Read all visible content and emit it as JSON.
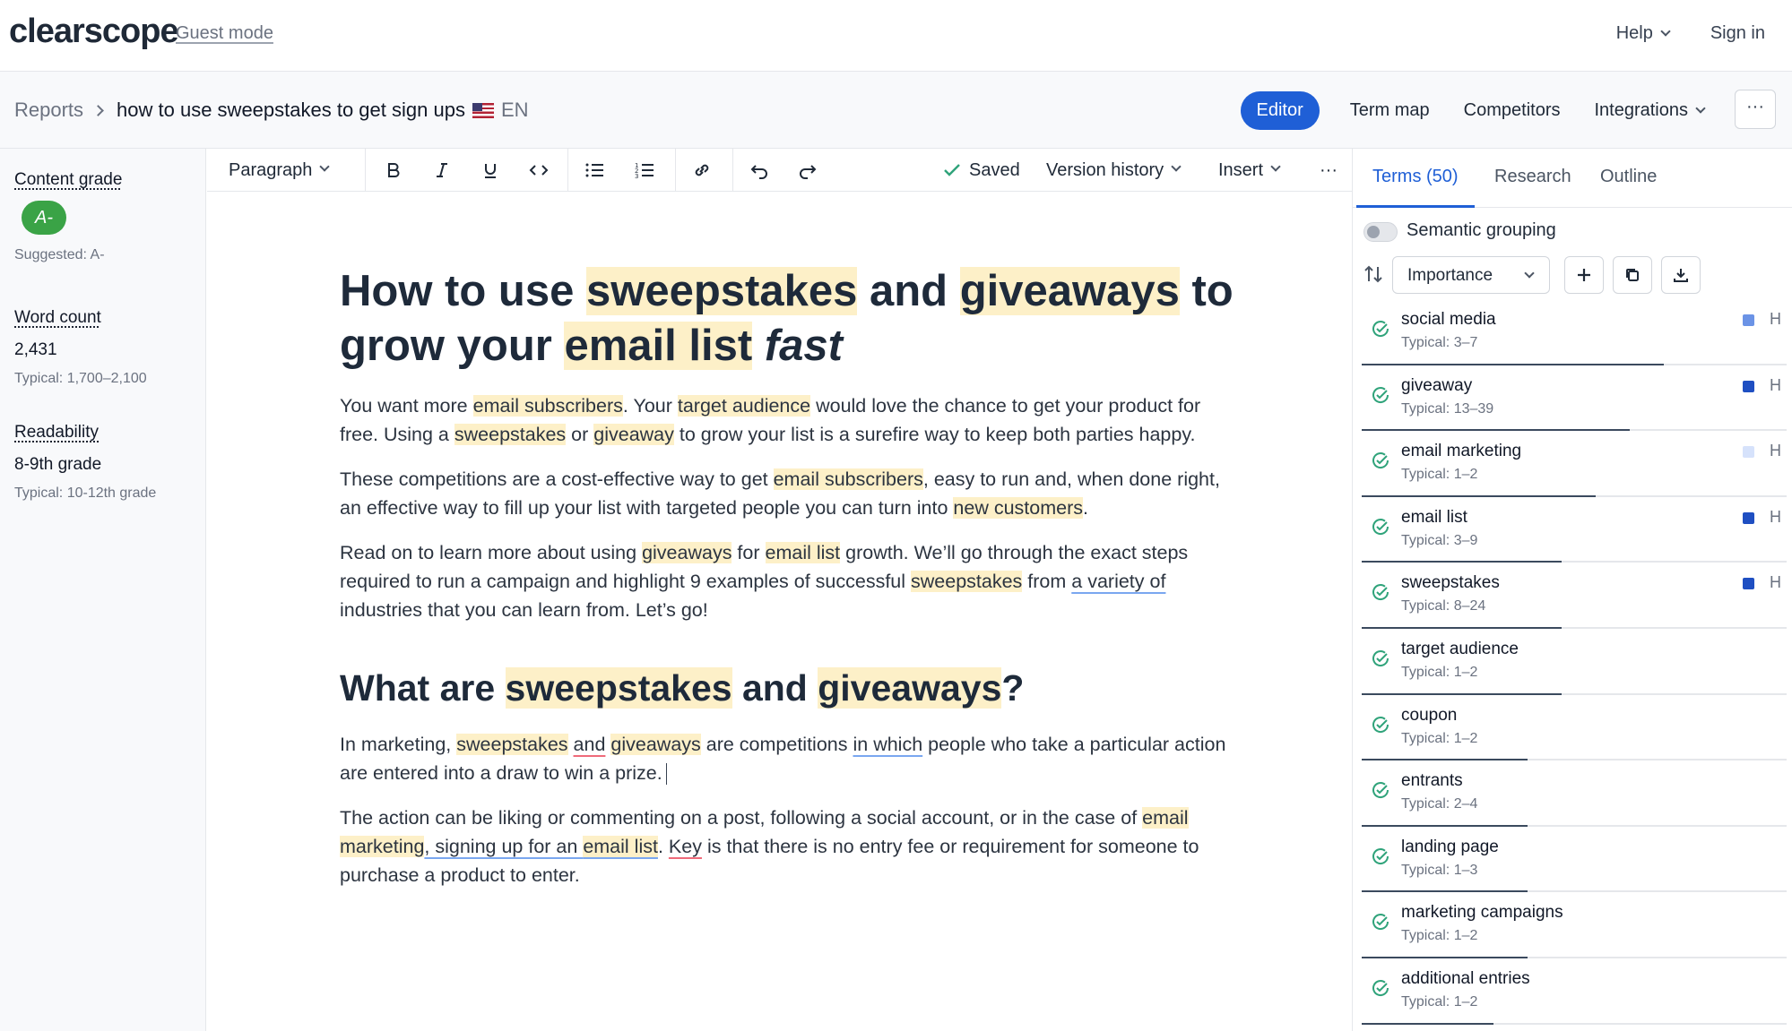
{
  "app": {
    "logo": "clearscope",
    "guest_mode": "Guest mode",
    "help": "Help",
    "sign_in": "Sign in"
  },
  "breadcrumb": {
    "reports": "Reports",
    "title": "how to use sweepstakes to get sign ups",
    "lang": "EN"
  },
  "subnav": {
    "editor": "Editor",
    "term_map": "Term map",
    "competitors": "Competitors",
    "integrations": "Integrations",
    "more": "···"
  },
  "sidebar": {
    "content_grade_label": "Content grade",
    "grade": "A-",
    "suggested": "Suggested: A-",
    "word_count_label": "Word count",
    "word_count": "2,431",
    "word_count_typical": "Typical: 1,700–2,100",
    "readability_label": "Readability",
    "readability": "8-9th grade",
    "readability_typical": "Typical: 10-12th grade"
  },
  "toolbar": {
    "paragraph": "Paragraph",
    "saved": "Saved",
    "version_history": "Version history",
    "insert": "Insert",
    "more": "···"
  },
  "document": {
    "h1": [
      {
        "t": "How to use "
      },
      {
        "t": "sweepstakes",
        "hl": true
      },
      {
        "t": " and "
      },
      {
        "t": "giveaways",
        "hl": true
      },
      {
        "t": " to grow your "
      },
      {
        "t": "email list",
        "hl": true
      },
      {
        "t": " "
      },
      {
        "t": "fast",
        "em": true
      }
    ],
    "p1": [
      {
        "t": "You want more "
      },
      {
        "t": "email subscribers",
        "hl": true
      },
      {
        "t": ". Your "
      },
      {
        "t": "target audience",
        "hl": true
      },
      {
        "t": " would love the chance to get your product for free. Using a "
      },
      {
        "t": "sweepstakes",
        "hl": true
      },
      {
        "t": " or "
      },
      {
        "t": "giveaway",
        "hl": true
      },
      {
        "t": " to grow your list is a surefire way to keep both parties happy."
      }
    ],
    "p2": [
      {
        "t": "These competitions are a cost-effective way to get "
      },
      {
        "t": "email subscribers",
        "hl": true
      },
      {
        "t": ", easy to run and, when done right, an effective way to fill up your list with targeted people you can turn into "
      },
      {
        "t": "new customers",
        "hl": true
      },
      {
        "t": "."
      }
    ],
    "p3": [
      {
        "t": "Read on to learn more about using "
      },
      {
        "t": "giveaways",
        "hl": true
      },
      {
        "t": " for "
      },
      {
        "t": "email list",
        "hl": true
      },
      {
        "t": " growth. We’ll go through the exact steps required to run a campaign and highlight 9 examples of successful "
      },
      {
        "t": "sweepstakes",
        "hl": true
      },
      {
        "t": " from "
      },
      {
        "t": "a variety of",
        "ub": true
      },
      {
        "t": " industries that you can learn from. Let’s go!"
      }
    ],
    "h2": [
      {
        "t": "What are "
      },
      {
        "t": "sweepstakes",
        "hl": true
      },
      {
        "t": " and "
      },
      {
        "t": "giveaways",
        "hl": true
      },
      {
        "t": "?"
      }
    ],
    "p4": [
      {
        "t": "In marketing, "
      },
      {
        "t": "sweepstakes",
        "hl": true
      },
      {
        "t": " "
      },
      {
        "t": "and",
        "ur": true
      },
      {
        "t": " "
      },
      {
        "t": "giveaways",
        "hl": true
      },
      {
        "t": " are competitions "
      },
      {
        "t": "in which",
        "ub": true
      },
      {
        "t": " people who take a particular action are entered into a draw to win a prize."
      }
    ],
    "p5": [
      {
        "t": "The action can be liking or commenting on a post, following a social account, or in the case of "
      },
      {
        "t": "email marketing",
        "hl": true
      },
      {
        "t": ", signing up for an ",
        "ub": true
      },
      {
        "t": "email list",
        "hl": true,
        "ub": true
      },
      {
        "t": ". "
      },
      {
        "t": "Key",
        "ur": true
      },
      {
        "t": " is that there is no entry fee or requirement for someone to purchase a product to enter."
      }
    ]
  },
  "right_panel": {
    "tabs": [
      "Terms (50)",
      "Research",
      "Outline"
    ],
    "semantic_grouping": "Semantic grouping",
    "sort_select": "Importance",
    "terms": [
      {
        "name": "social media",
        "typical": "Typical: 3–7",
        "progress": 0.71,
        "importance_color": "#6b93e6",
        "h": "H"
      },
      {
        "name": "giveaway",
        "typical": "Typical: 13–39",
        "progress": 0.63,
        "importance_color": "#1f4fc2",
        "h": "H"
      },
      {
        "name": "email marketing",
        "typical": "Typical: 1–2",
        "progress": 0.55,
        "importance_color": "#d6e2fb",
        "h": "H"
      },
      {
        "name": "email list",
        "typical": "Typical: 3–9",
        "progress": 0.47,
        "importance_color": "#1f4fc2",
        "h": "H"
      },
      {
        "name": "sweepstakes",
        "typical": "Typical: 8–24",
        "progress": 0.47,
        "importance_color": "#1f4fc2",
        "h": "H"
      },
      {
        "name": "target audience",
        "typical": "Typical: 1–2",
        "progress": 0.47,
        "importance_color": "",
        "h": ""
      },
      {
        "name": "coupon",
        "typical": "Typical: 1–2",
        "progress": 0.39,
        "importance_color": "",
        "h": ""
      },
      {
        "name": "entrants",
        "typical": "Typical: 2–4",
        "progress": 0.39,
        "importance_color": "",
        "h": ""
      },
      {
        "name": "landing page",
        "typical": "Typical: 1–3",
        "progress": 0.39,
        "importance_color": "",
        "h": ""
      },
      {
        "name": "marketing campaigns",
        "typical": "Typical: 1–2",
        "progress": 0.39,
        "importance_color": "",
        "h": ""
      },
      {
        "name": "additional entries",
        "typical": "Typical: 1–2",
        "progress": 0.31,
        "importance_color": "",
        "h": ""
      }
    ]
  },
  "colors": {
    "accent": "#1f5fd6",
    "grade_green": "#3aa346",
    "highlight": "#fdf0c8",
    "check_green": "#2fa37a"
  }
}
